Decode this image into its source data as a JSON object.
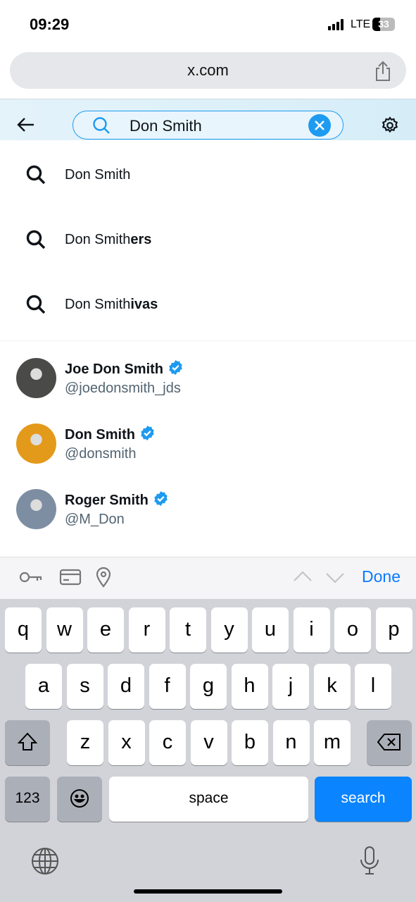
{
  "status": {
    "time": "09:29",
    "network": "LTE",
    "battery": "33",
    "battery_level_pct": 33
  },
  "browser": {
    "url": "x.com",
    "share_icon": "share-icon"
  },
  "search": {
    "query": "Don Smith",
    "back_icon": "arrow-left-icon",
    "settings_icon": "gear-icon"
  },
  "suggestions": [
    {
      "prefix": "Don Smith",
      "suffix": ""
    },
    {
      "prefix": "Don Smith",
      "suffix": "ers"
    },
    {
      "prefix": "Don Smith",
      "suffix": "ivas"
    }
  ],
  "users": [
    {
      "name": "Joe Don Smith",
      "handle": "@joedonsmith_jds",
      "verified": true,
      "avatar_color": "#4a4a48"
    },
    {
      "name": "Don Smith",
      "handle": "@donsmith",
      "verified": true,
      "avatar_color": "#e39a1b"
    },
    {
      "name": "Roger Smith",
      "handle": "@M_Don",
      "verified": true,
      "avatar_color": "#7d8ea3"
    }
  ],
  "accessory": {
    "done": "Done",
    "icons": [
      "key-icon",
      "credit-card-icon",
      "location-pin-icon",
      "chevron-up-icon",
      "chevron-down-icon"
    ]
  },
  "keyboard": {
    "rows": [
      [
        "q",
        "w",
        "e",
        "r",
        "t",
        "y",
        "u",
        "i",
        "o",
        "p"
      ],
      [
        "a",
        "s",
        "d",
        "f",
        "g",
        "h",
        "j",
        "k",
        "l"
      ],
      [
        "z",
        "x",
        "c",
        "v",
        "b",
        "n",
        "m"
      ]
    ],
    "numbers": "123",
    "space": "space",
    "search": "search"
  },
  "colors": {
    "accent": "#1d9bf0",
    "keyboard_action": "#0a84ff"
  }
}
